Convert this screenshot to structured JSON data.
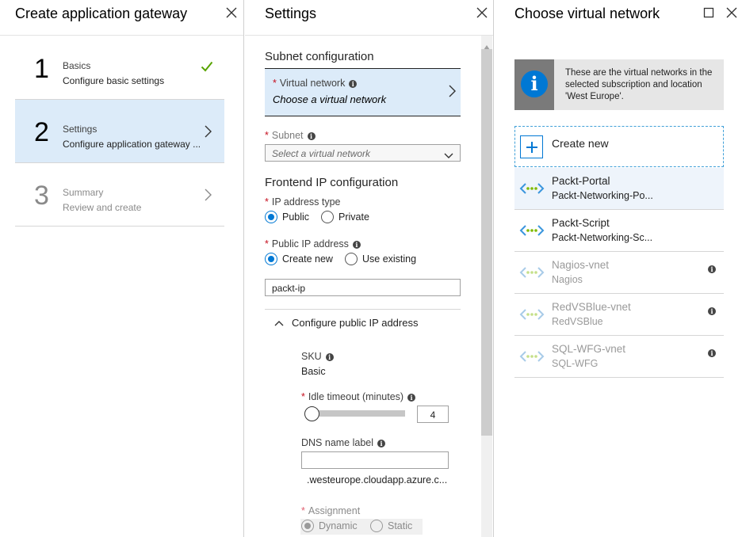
{
  "blade1": {
    "title": "Create application gateway",
    "steps": [
      {
        "num": "1",
        "title": "Basics",
        "subtitle": "Configure basic settings"
      },
      {
        "num": "2",
        "title": "Settings",
        "subtitle": "Configure application gateway ..."
      },
      {
        "num": "3",
        "title": "Summary",
        "subtitle": "Review and create"
      }
    ]
  },
  "blade2": {
    "title": "Settings",
    "subnet_section": "Subnet configuration",
    "virtual_network_label": "Virtual network",
    "virtual_network_value": "Choose a virtual network",
    "subnet_label": "Subnet",
    "subnet_placeholder": "Select a virtual network",
    "frontend_section": "Frontend IP configuration",
    "ip_type_label": "IP address type",
    "ip_type_public": "Public",
    "ip_type_private": "Private",
    "public_ip_label": "Public IP address",
    "public_ip_create": "Create new",
    "public_ip_existing": "Use existing",
    "public_ip_name": "packt-ip",
    "expander_label": "Configure public IP address",
    "sku_label": "SKU",
    "sku_value": "Basic",
    "idle_label": "Idle timeout (minutes)",
    "idle_value": "4",
    "idle_fraction": 0.0,
    "dns_label": "DNS name label",
    "dns_value": "",
    "dns_suffix": ".westeurope.cloudapp.azure.c...",
    "assignment_label": "Assignment",
    "assignment_dynamic": "Dynamic",
    "assignment_static": "Static"
  },
  "blade3": {
    "title": "Choose virtual network",
    "info_text": "These are the virtual networks in the selected subscription and location 'West Europe'.",
    "create_new": "Create new",
    "networks": [
      {
        "name": "Packt-Portal",
        "sub": "Packt-Networking-Po..."
      },
      {
        "name": "Packt-Script",
        "sub": "Packt-Networking-Sc..."
      },
      {
        "name": "Nagios-vnet",
        "sub": "Nagios"
      },
      {
        "name": "RedVSBlue-vnet",
        "sub": "RedVSBlue"
      },
      {
        "name": "SQL-WFG-vnet",
        "sub": "SQL-WFG"
      }
    ]
  },
  "icons": {
    "close": "close-icon",
    "maximize": "maximize-icon",
    "check": "checkmark-icon",
    "chevron": "chevron-right-icon",
    "info": "info-icon",
    "vnet": "virtual-network-icon"
  },
  "colors": {
    "accent": "#0078d4",
    "selected_bg": "#dcebf9",
    "check_green": "#57a300"
  }
}
